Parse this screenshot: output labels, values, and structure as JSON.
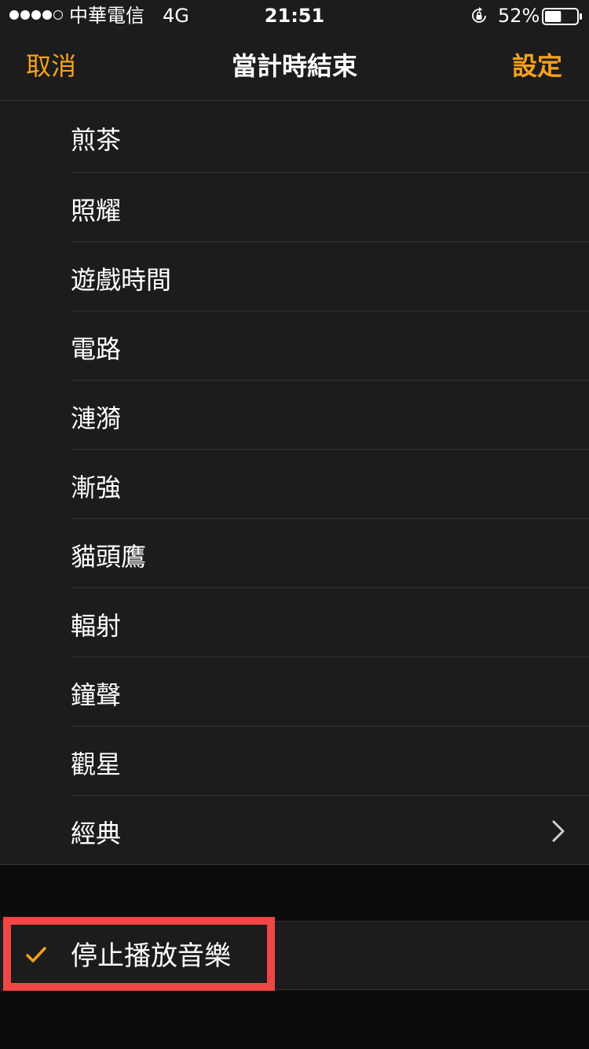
{
  "status_bar": {
    "carrier": "中華電信",
    "network": "4G",
    "time": "21:51",
    "battery_percent": "52%",
    "battery_level": 0.52
  },
  "nav": {
    "cancel_label": "取消",
    "title": "當計時結束",
    "set_label": "設定"
  },
  "ringtones": [
    {
      "label": "煎茶"
    },
    {
      "label": "照耀"
    },
    {
      "label": "遊戲時間"
    },
    {
      "label": "電路"
    },
    {
      "label": "漣漪"
    },
    {
      "label": "漸強"
    },
    {
      "label": "貓頭鷹"
    },
    {
      "label": "輻射"
    },
    {
      "label": "鐘聲"
    },
    {
      "label": "觀星"
    },
    {
      "label": "經典"
    }
  ],
  "stop_option": {
    "label": "停止播放音樂",
    "selected": true
  },
  "colors": {
    "accent": "#f7a11a",
    "highlight": "#f04646",
    "background": "#1c1c1c"
  },
  "icons": {
    "lock": "rotation-lock-icon",
    "battery": "battery-icon",
    "chevron": "chevron-right-icon",
    "check": "checkmark-icon"
  }
}
